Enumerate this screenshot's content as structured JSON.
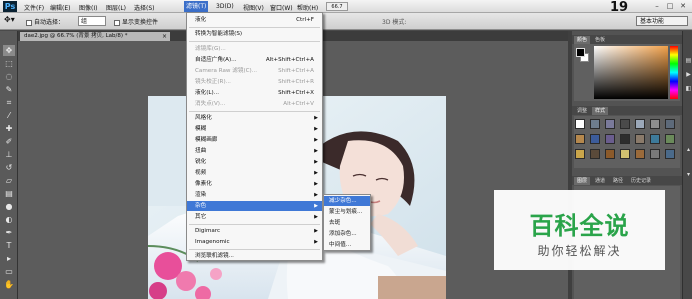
{
  "menubar": {
    "logo": "Ps",
    "items": [
      "文件(F)",
      "编辑(E)",
      "图像(I)",
      "图层(L)",
      "选择(S)",
      "滤镜(T)",
      "3D(D)",
      "视图(V)",
      "窗口(W)",
      "帮助(H)"
    ],
    "zoom": "66.7",
    "page_number": "19",
    "min": "–",
    "max": "□",
    "close": "✕"
  },
  "options": {
    "auto_select": "自动选择：",
    "auto_select_value": "组",
    "show_transform": "显示变换控件",
    "mode_3d": "3D 模式:",
    "workspace": "基本功能"
  },
  "document": {
    "tab": "dae2.jpg @ 66.7% (背景 拷贝, Lab/8) *",
    "close": "×"
  },
  "filter_menu": {
    "items": [
      {
        "label": "液化",
        "shortcut": "Ctrl+F",
        "disabled": false
      },
      {
        "label": "转换为智能滤镜(S)",
        "shortcut": "",
        "disabled": false
      },
      {
        "label": "滤镜库(G)...",
        "shortcut": "",
        "disabled": true
      },
      {
        "label": "自适应广角(A)...",
        "shortcut": "Alt+Shift+Ctrl+A",
        "disabled": false
      },
      {
        "label": "Camera Raw 滤镜(C)...",
        "shortcut": "Shift+Ctrl+A",
        "disabled": true
      },
      {
        "label": "镜头校正(R)...",
        "shortcut": "Shift+Ctrl+R",
        "disabled": true
      },
      {
        "label": "液化(L)...",
        "shortcut": "Shift+Ctrl+X",
        "disabled": false
      },
      {
        "label": "消失点(V)...",
        "shortcut": "Alt+Ctrl+V",
        "disabled": true
      },
      {
        "label": "风格化",
        "shortcut": "",
        "disabled": false,
        "sub": true
      },
      {
        "label": "模糊",
        "shortcut": "",
        "disabled": false,
        "sub": true
      },
      {
        "label": "模糊画廊",
        "shortcut": "",
        "disabled": false,
        "sub": true
      },
      {
        "label": "扭曲",
        "shortcut": "",
        "disabled": false,
        "sub": true
      },
      {
        "label": "锐化",
        "shortcut": "",
        "disabled": false,
        "sub": true
      },
      {
        "label": "视频",
        "shortcut": "",
        "disabled": false,
        "sub": true
      },
      {
        "label": "像素化",
        "shortcut": "",
        "disabled": false,
        "sub": true
      },
      {
        "label": "渲染",
        "shortcut": "",
        "disabled": false,
        "sub": true
      },
      {
        "label": "杂色",
        "shortcut": "",
        "disabled": false,
        "sub": true,
        "highlight": true
      },
      {
        "label": "其它",
        "shortcut": "",
        "disabled": false,
        "sub": true
      },
      {
        "label": "Digimarc",
        "shortcut": "",
        "disabled": false,
        "sub": true
      },
      {
        "label": "Imagenomic",
        "shortcut": "",
        "disabled": false,
        "sub": true
      },
      {
        "label": "浏览联机滤镜...",
        "shortcut": "",
        "disabled": false
      }
    ]
  },
  "noise_submenu": {
    "items": [
      "减少杂色...",
      "蒙尘与划痕...",
      "去斑",
      "添加杂色...",
      "中间值..."
    ]
  },
  "panels": {
    "color_tabs": [
      "颜色",
      "色板"
    ],
    "styles_tabs": [
      "调整",
      "样式"
    ],
    "layers_tabs": [
      "图层",
      "通道",
      "路径",
      "历史记录"
    ]
  },
  "watermark": {
    "title": "百科全说",
    "subtitle": "助你轻松解决"
  },
  "colors": {
    "menu_highlight": "#3f78d6",
    "watermark_green": "#2aa44a"
  }
}
